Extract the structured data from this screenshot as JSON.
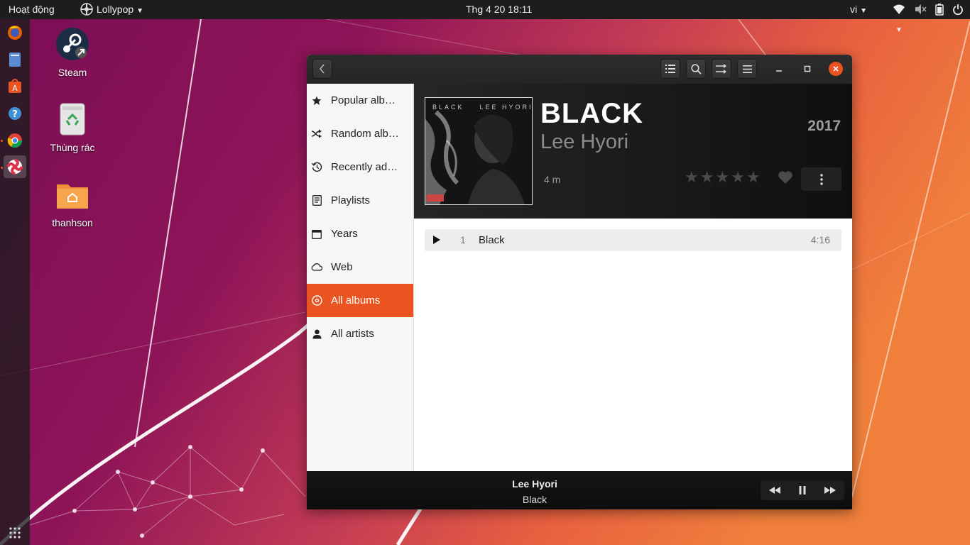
{
  "topbar": {
    "activities": "Hoạt động",
    "app_menu": "Lollypop",
    "clock": "Thg 4 20  18:11",
    "language": "vi",
    "icons": [
      "network-wifi-icon",
      "volume-muted-icon",
      "battery-icon",
      "power-icon"
    ]
  },
  "dock": {
    "items": [
      "firefox-icon",
      "files-icon",
      "software-center-icon",
      "help-icon",
      "chrome-icon",
      "lollypop-icon"
    ],
    "show_apps": "apps-grid-icon"
  },
  "desktop": {
    "icons": [
      {
        "label": "Steam",
        "icon": "steam-icon"
      },
      {
        "label": "Thùng rác",
        "icon": "trash-icon"
      },
      {
        "label": "thanhson",
        "icon": "home-folder-icon"
      }
    ]
  },
  "window": {
    "header_icons": [
      "back-icon",
      "list-view-icon",
      "search-icon",
      "shuffle-icon",
      "menu-icon",
      "minimize-icon",
      "maximize-icon",
      "close-icon"
    ],
    "accent": "#e95420",
    "sidebar": {
      "items": [
        {
          "label": "Popular alb…",
          "icon": "star-icon"
        },
        {
          "label": "Random alb…",
          "icon": "shuffle-icon"
        },
        {
          "label": "Recently ad…",
          "icon": "history-icon"
        },
        {
          "label": "Playlists",
          "icon": "playlist-icon"
        },
        {
          "label": "Years",
          "icon": "calendar-icon"
        },
        {
          "label": "Web",
          "icon": "cloud-icon"
        },
        {
          "label": "All albums",
          "icon": "disc-icon",
          "selected": true
        },
        {
          "label": "All artists",
          "icon": "person-icon"
        }
      ]
    },
    "album": {
      "cover_text": "BLACK    LEE HYORI",
      "title": "BLACK",
      "artist": "Lee Hyori",
      "year": "2017",
      "duration": "4 m",
      "rating": 0
    },
    "tracks": [
      {
        "number": "1",
        "title": "Black",
        "length": "4:16"
      }
    ],
    "player": {
      "artist": "Lee Hyori",
      "title": "Black",
      "controls": [
        "previous-icon",
        "pause-icon",
        "next-icon"
      ]
    }
  }
}
